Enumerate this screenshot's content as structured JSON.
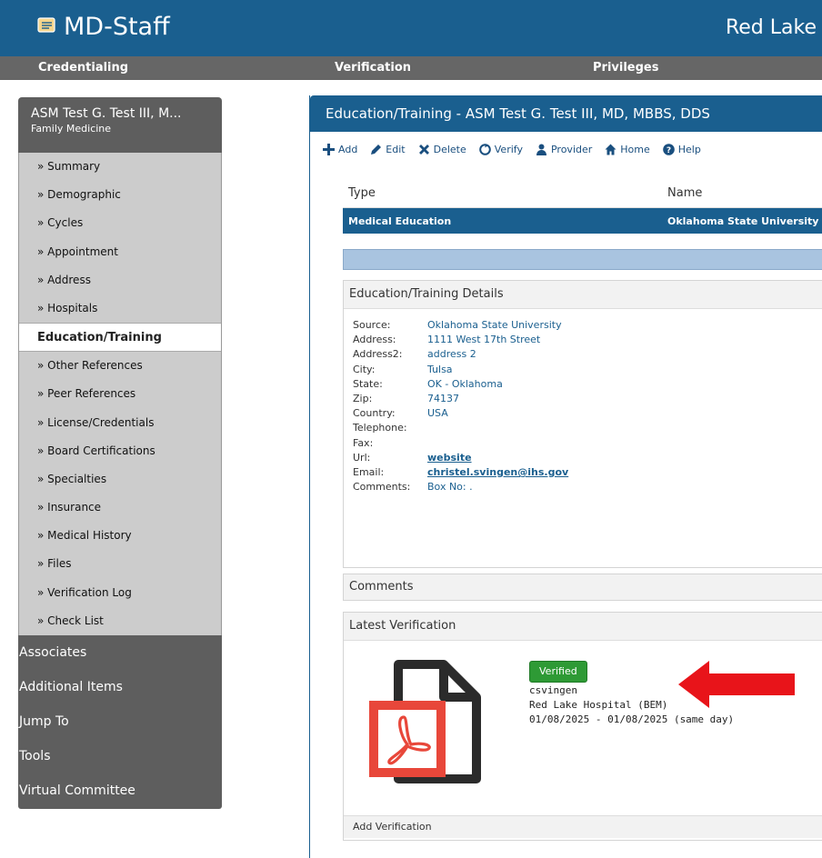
{
  "app": {
    "title": "MD-Staff",
    "facility": "Red Lake"
  },
  "nav": [
    "Credentialing",
    "Verification",
    "Privileges"
  ],
  "sidebar": {
    "provider_name": "ASM Test G. Test III, M...",
    "specialty": "Family Medicine",
    "items_top": [
      "» Summary",
      "» Demographic",
      "» Cycles",
      "» Appointment",
      "» Address",
      "» Hospitals"
    ],
    "active": "Education/Training",
    "items_bottom": [
      "» Other References",
      "» Peer References",
      "» License/Credentials",
      "» Board Certifications",
      "» Specialties",
      "» Insurance",
      "» Medical History",
      "» Files",
      "» Verification Log",
      "» Check List"
    ],
    "groups": [
      "Associates",
      "Additional Items",
      "Jump To",
      "Tools",
      "Virtual Committee"
    ]
  },
  "panel": {
    "title": "Education/Training - ASM Test G. Test III, MD, MBBS, DDS",
    "toolbar": [
      "Add",
      "Edit",
      "Delete",
      "Verify",
      "Provider",
      "Home",
      "Help"
    ]
  },
  "grid": {
    "headers": {
      "type": "Type",
      "name": "Name"
    },
    "rows": [
      {
        "type": "Medical Education",
        "name": "Oklahoma State University"
      }
    ]
  },
  "details": {
    "title": "Education/Training Details",
    "fields": [
      {
        "label": "Source:",
        "value": "Oklahoma State University"
      },
      {
        "label": "Address:",
        "value": "1111 West 17th Street"
      },
      {
        "label": "Address2:",
        "value": "address 2"
      },
      {
        "label": "City:",
        "value": "Tulsa"
      },
      {
        "label": "State:",
        "value": "OK - Oklahoma"
      },
      {
        "label": "Zip:",
        "value": "74137"
      },
      {
        "label": "Country:",
        "value": "USA"
      },
      {
        "label": "Telephone:",
        "value": ""
      },
      {
        "label": "Fax:",
        "value": ""
      },
      {
        "label": "Url:",
        "value": "website",
        "link": true
      },
      {
        "label": "Email:",
        "value": "christel.svingen@ihs.gov",
        "link": true
      },
      {
        "label": "Comments:",
        "value": "Box No: ."
      }
    ]
  },
  "comments": {
    "title": "Comments"
  },
  "verification": {
    "title": "Latest Verification",
    "status": "Verified",
    "user": "csvingen",
    "facility": "Red Lake Hospital (BEM)",
    "dates": "01/08/2025 - 01/08/2025 (same day)",
    "add_label": "Add Verification"
  },
  "colors": {
    "brand": "#1a5f8f",
    "nav": "#666666",
    "verified": "#2e9a35",
    "arrow": "#e8141a",
    "pdf": "#e8473a"
  },
  "icons": [
    "file-icon",
    "plus-icon",
    "pencil-icon",
    "x-icon",
    "verify-icon",
    "person-icon",
    "home-icon",
    "help-icon",
    "pdf-file-icon",
    "red-arrow-icon"
  ]
}
